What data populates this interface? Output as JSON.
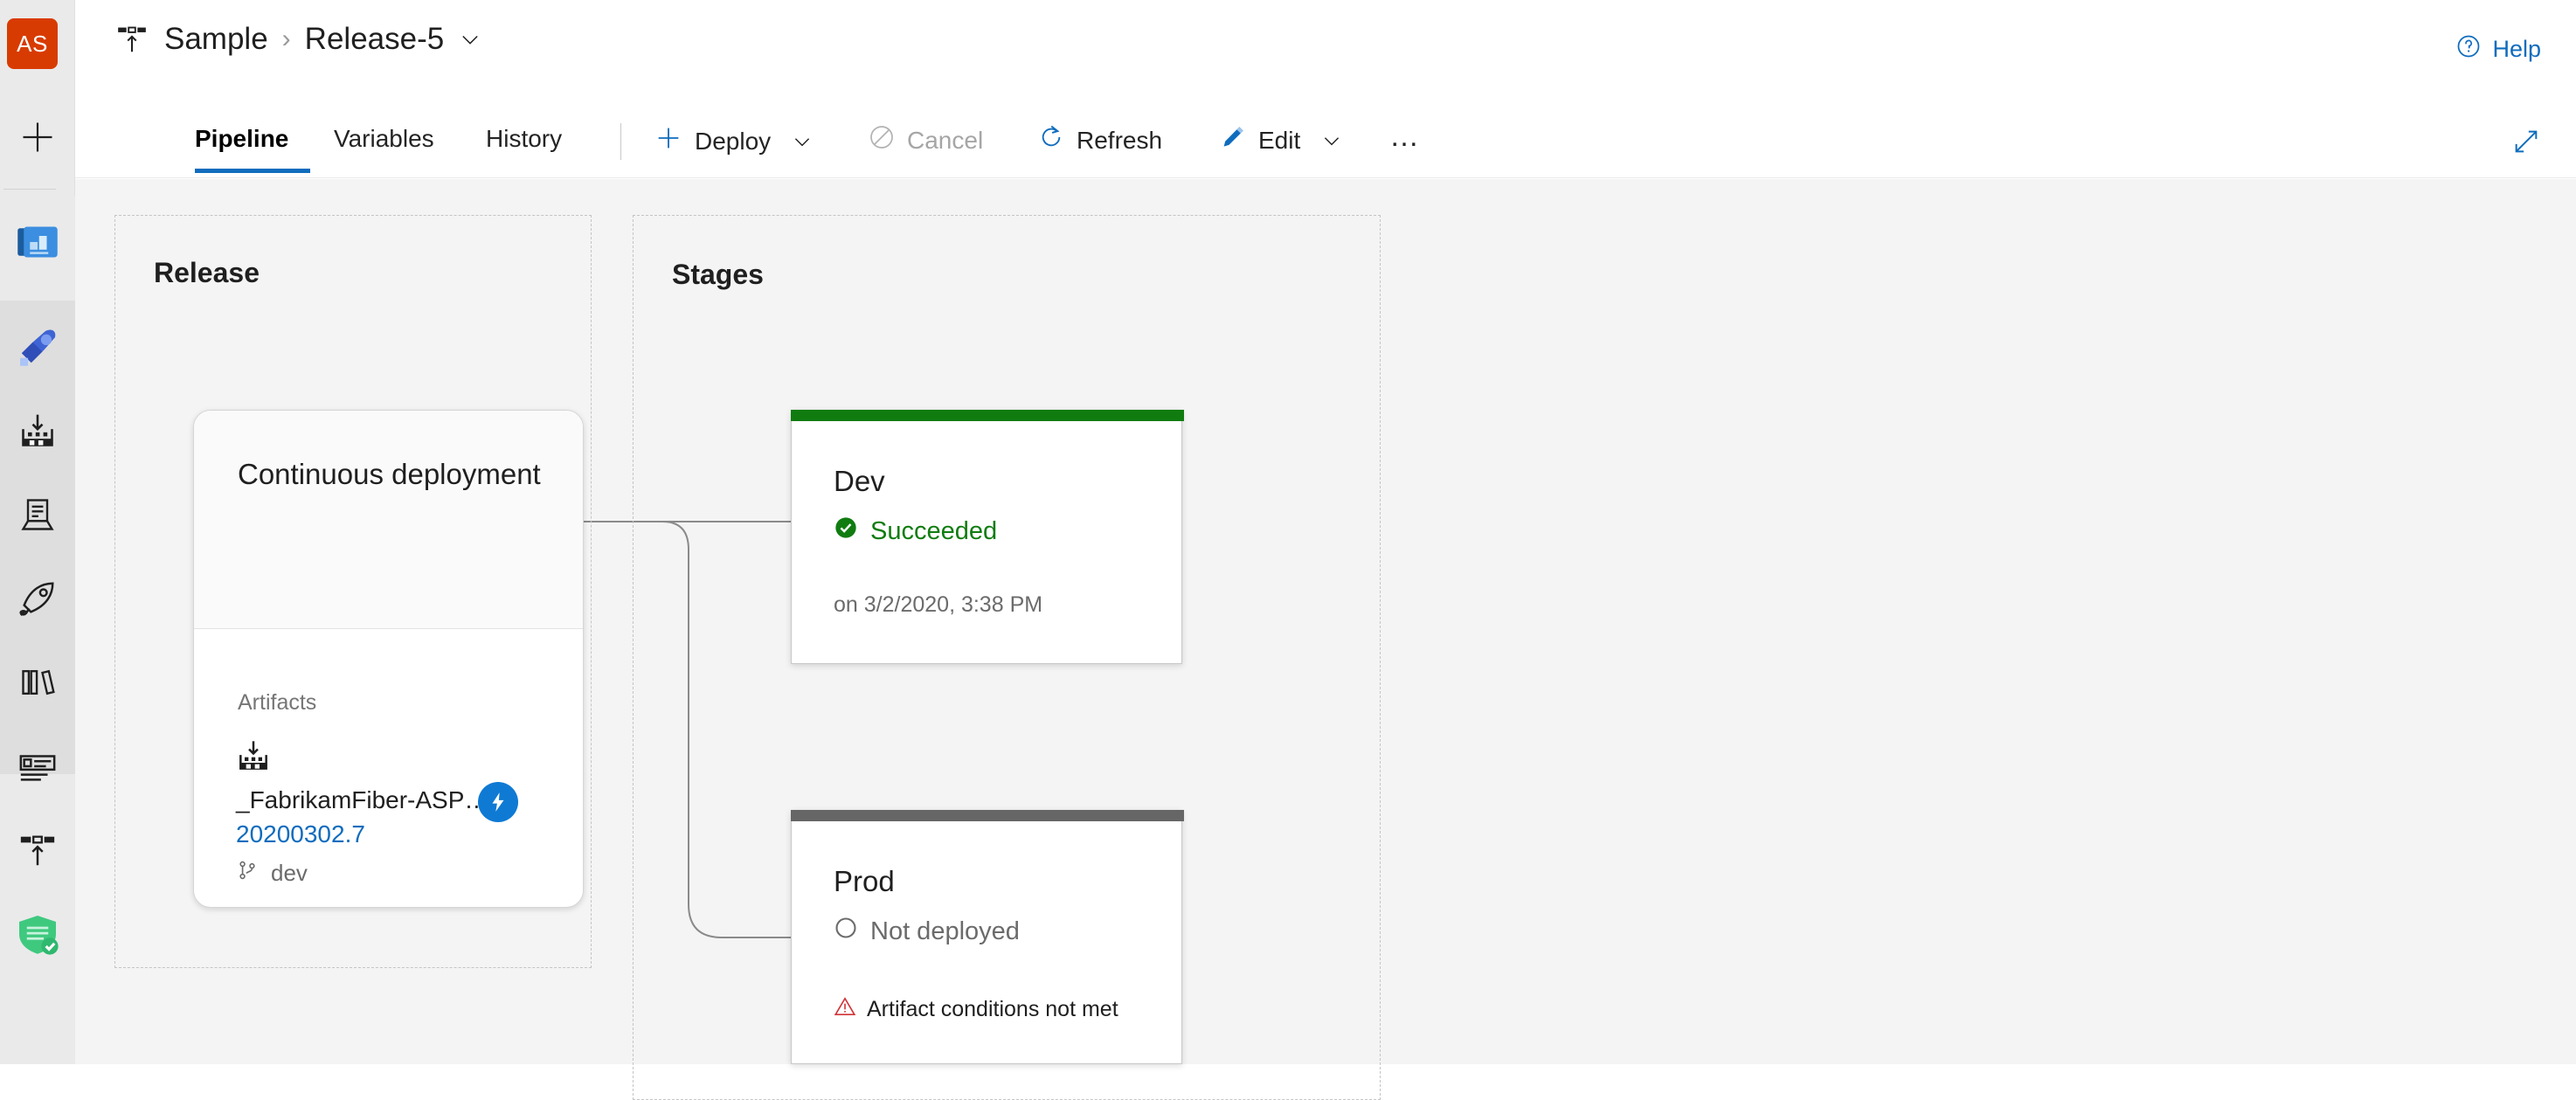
{
  "rail": {
    "avatar_initials": "AS",
    "accent_color": "#d83b01",
    "items": [
      {
        "name": "add-icon",
        "label": "Add"
      },
      {
        "name": "project-icon",
        "label": "Project"
      },
      {
        "name": "boards-icon",
        "label": "Boards"
      },
      {
        "name": "repos-icon",
        "label": "Repos"
      },
      {
        "name": "pipelines-icon",
        "label": "Pipelines"
      },
      {
        "name": "releases-icon",
        "label": "Releases"
      },
      {
        "name": "library-icon",
        "label": "Library"
      },
      {
        "name": "task-groups-icon",
        "label": "Task groups"
      },
      {
        "name": "deployment-groups-icon",
        "label": "Deployment groups"
      },
      {
        "name": "security-icon",
        "label": "Security"
      }
    ]
  },
  "header": {
    "breadcrumb_icon": "release-pipeline-icon",
    "project": "Sample",
    "separator": "›",
    "release_name": "Release-5",
    "chevron": "chevron-down-icon",
    "help_label": "Help",
    "help_icon": "help-circle-icon",
    "accent_color": "#0f6cbd"
  },
  "command_bar": {
    "tabs": [
      {
        "label": "Pipeline",
        "active": true
      },
      {
        "label": "Variables",
        "active": false
      },
      {
        "label": "History",
        "active": false
      }
    ],
    "commands": [
      {
        "label": "Deploy",
        "icon": "plus-icon",
        "has_chevron": true,
        "disabled": false
      },
      {
        "label": "Cancel",
        "icon": "cancel-icon",
        "has_chevron": false,
        "disabled": true
      },
      {
        "label": "Refresh",
        "icon": "refresh-icon",
        "has_chevron": false,
        "disabled": false
      },
      {
        "label": "Edit",
        "icon": "pencil-icon",
        "has_chevron": true,
        "disabled": false
      },
      {
        "label": "…",
        "icon": "more-icon",
        "has_chevron": false,
        "disabled": false
      }
    ],
    "expand_icon": "expand-diagonal-icon"
  },
  "canvas": {
    "release_section": {
      "title": "Release",
      "card": {
        "title": "Continuous deployment",
        "artifacts_label": "Artifacts",
        "artifact": {
          "icon": "build-artifact-icon",
          "name": "_FabrikamFiber-ASP…",
          "version": "20200302.7",
          "branch_icon": "branch-icon",
          "branch": "dev",
          "trigger_badge_icon": "lightning-icon",
          "trigger_badge_color": "#0f7ad4"
        }
      }
    },
    "stages_section": {
      "title": "Stages",
      "stages": [
        {
          "name": "Dev",
          "status": "Succeeded",
          "status_icon": "check-circle-icon",
          "status_color": "#107c10",
          "strip_color": "#107c10",
          "meta": "on 3/2/2020, 3:38 PM",
          "warning": null
        },
        {
          "name": "Prod",
          "status": "Not deployed",
          "status_icon": "empty-circle-icon",
          "status_color": "#6b6b6b",
          "strip_color": "#666666",
          "meta": null,
          "warning": "Artifact conditions not met",
          "warning_icon": "warning-triangle-icon",
          "warning_color": "#d13438"
        }
      ]
    }
  }
}
